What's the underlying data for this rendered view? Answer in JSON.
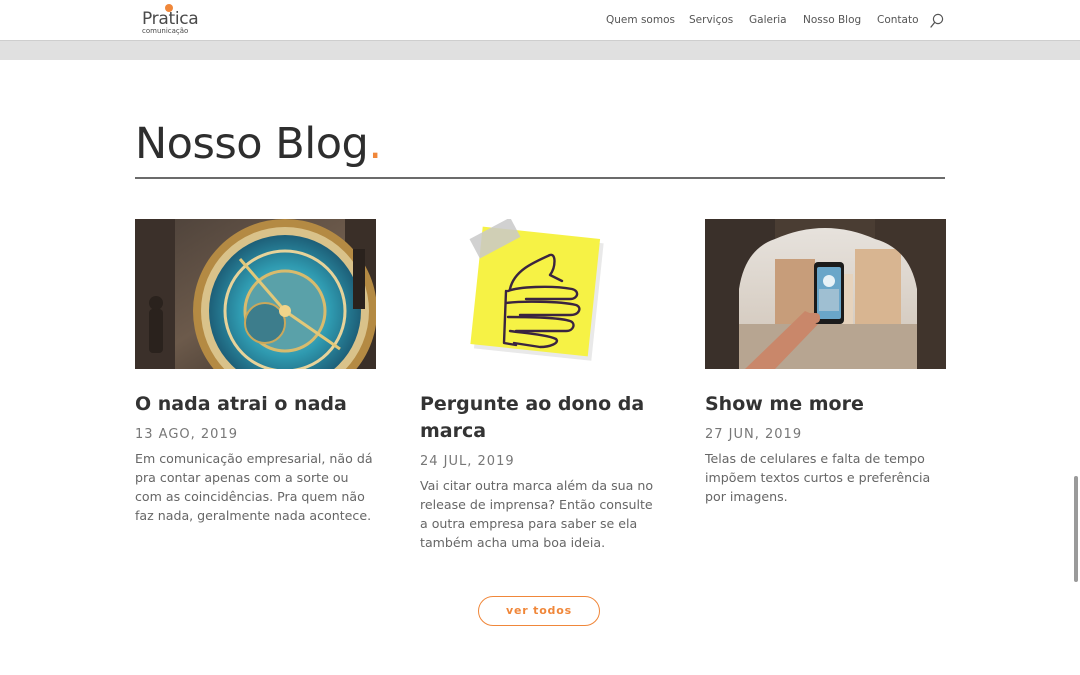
{
  "header": {
    "logo": {
      "name": "Pratica",
      "tagline": "comunicação"
    },
    "nav": [
      {
        "label": "Quem somos"
      },
      {
        "label": "Serviços"
      },
      {
        "label": "Galeria"
      },
      {
        "label": "Nosso Blog"
      },
      {
        "label": "Contato"
      }
    ],
    "search_icon": "search-icon"
  },
  "section": {
    "title": "Nosso Blog",
    "title_dot": "."
  },
  "posts": [
    {
      "title": "O nada atrai o nada",
      "date": "13 AGO, 2019",
      "excerpt": "Em comunicação empresarial, não dá pra contar apenas com a sorte ou com as coincidências. Pra quem não faz nada, geralmente nada acontece.",
      "image": "astronomical-clock"
    },
    {
      "title": "Pergunte ao dono da marca",
      "date": "24 JUL, 2019",
      "excerpt": "Vai citar outra marca além da sua no release de imprensa? Então consulte a outra empresa para saber se ela também acha uma boa ideia.",
      "image": "thumbs-up-sticky-note"
    },
    {
      "title": "Show me more",
      "date": "27 JUN, 2019",
      "excerpt": "Telas de celulares e falta de tempo impõem textos curtos e preferência por imagens.",
      "image": "hand-holding-phone"
    }
  ],
  "more_button": {
    "label": "ver todos"
  },
  "colors": {
    "accent": "#f0873a",
    "text": "#333333",
    "rule": "#6b6b6b"
  }
}
